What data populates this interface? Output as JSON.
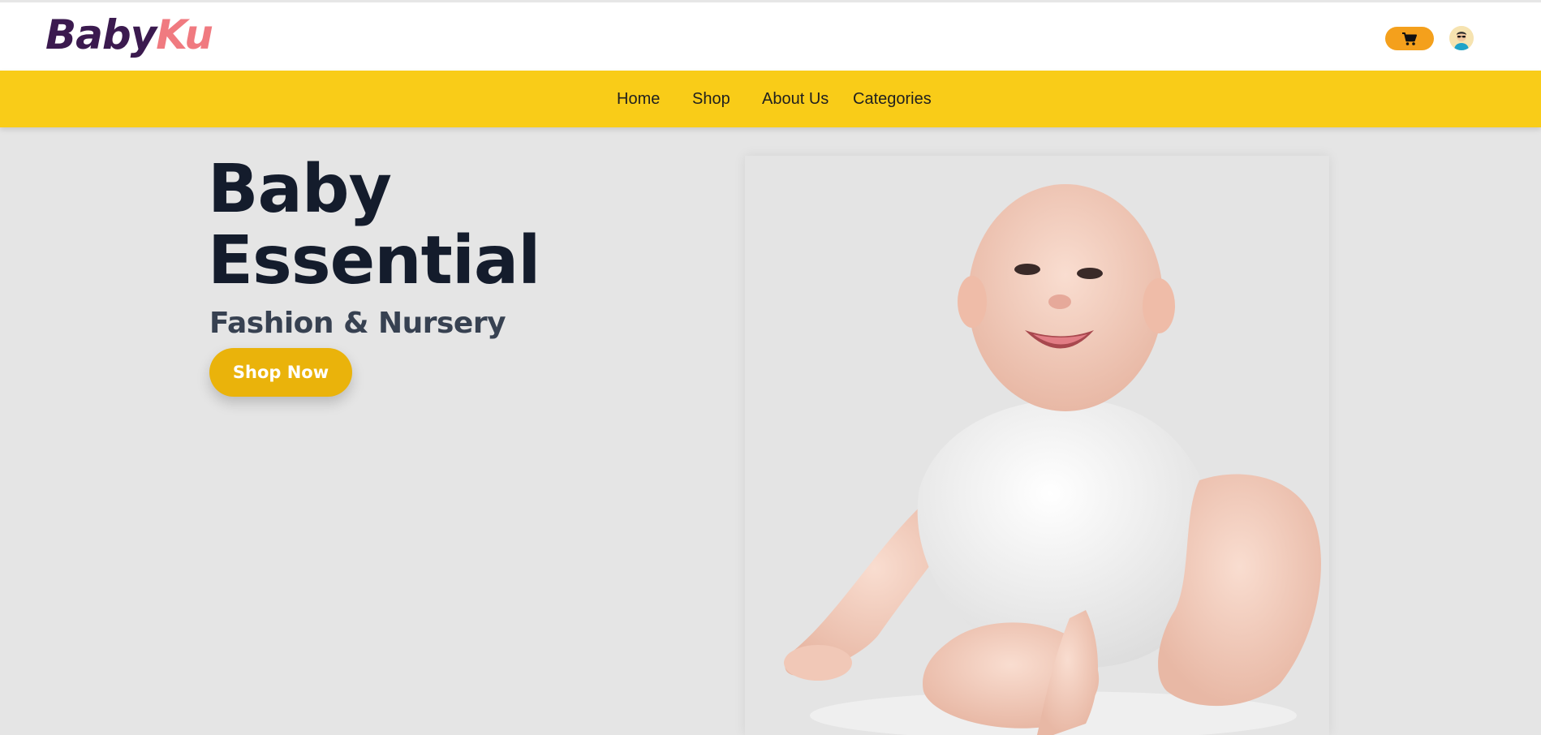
{
  "brand": {
    "part1": "Baby",
    "part2": "Ku",
    "color1": "#3b1a4f",
    "color2": "#f07a80"
  },
  "header": {
    "cart_icon": "shopping-cart-icon",
    "avatar_icon": "user-avatar-icon",
    "accent": "#f4a01c"
  },
  "nav": {
    "background": "#f9cc18",
    "items": [
      {
        "label": "Home"
      },
      {
        "label": "Shop"
      },
      {
        "label": "About Us"
      },
      {
        "label": "Categories"
      }
    ]
  },
  "hero": {
    "title_line1": "Baby",
    "title_line2": "Essential",
    "subtitle": "Fashion & Nursery",
    "cta_label": "Shop Now",
    "cta_color": "#eab30b",
    "image_subject": "smiling baby in white bodysuit"
  }
}
